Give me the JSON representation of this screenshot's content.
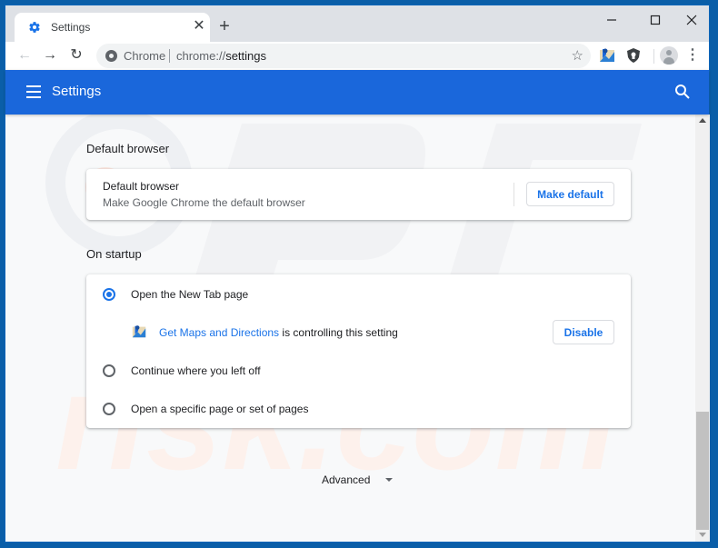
{
  "window": {
    "minimize_icon": "minimize-icon",
    "maximize_icon": "maximize-icon",
    "close_icon": "close-icon"
  },
  "tab": {
    "title": "Settings",
    "icon": "gear-icon",
    "close_glyph": "✕",
    "new_tab_glyph": "+"
  },
  "toolbar": {
    "back_glyph": "←",
    "forward_glyph": "→",
    "reload_glyph": "↻",
    "origin_label": "Chrome",
    "url_scheme": "chrome://",
    "url_path": "settings",
    "star_glyph": "☆",
    "kebab_glyph": "⋮"
  },
  "header": {
    "title": "Settings"
  },
  "default_browser": {
    "section_title": "Default browser",
    "row_title": "Default browser",
    "row_subtitle": "Make Google Chrome the default browser",
    "button_label": "Make default"
  },
  "on_startup": {
    "section_title": "On startup",
    "options": [
      {
        "label": "Open the New Tab page",
        "selected": true
      },
      {
        "label": "Continue where you left off",
        "selected": false
      },
      {
        "label": "Open a specific page or set of pages",
        "selected": false
      }
    ],
    "extension_notice": {
      "extension_name": "Get Maps and Directions",
      "suffix": " is controlling this setting",
      "button_label": "Disable"
    }
  },
  "advanced": {
    "label": "Advanced"
  },
  "colors": {
    "accent": "#1a73e8",
    "header_bg": "#1a67db",
    "frame": "#0a5ea8"
  }
}
